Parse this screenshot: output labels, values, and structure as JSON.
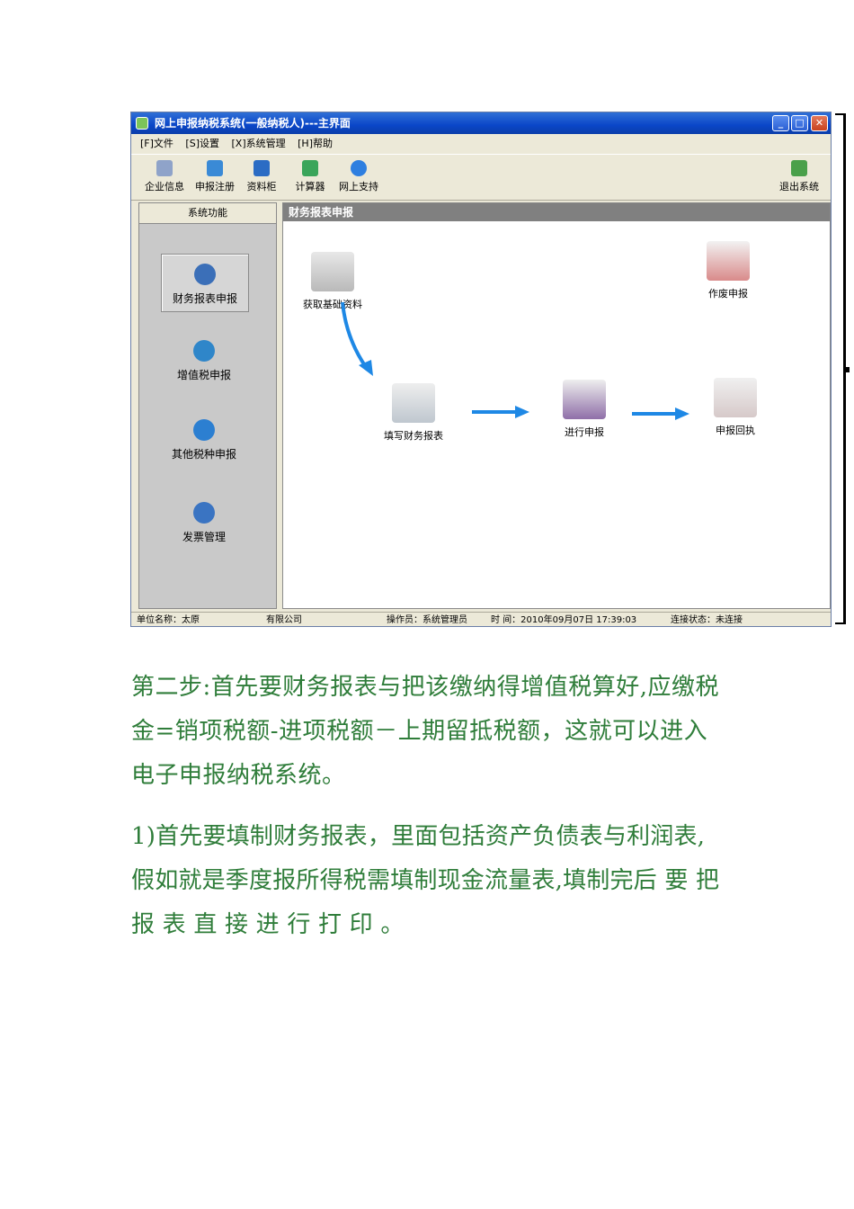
{
  "window": {
    "title": "网上申报纳税系统(一般纳税人)---主界面",
    "menu": [
      "[F]文件",
      "[S]设置",
      "[X]系统管理",
      "[H]帮助"
    ],
    "toolbar": [
      "企业信息",
      "申报注册",
      "资料柜",
      "计算器",
      "网上支持"
    ],
    "toolbar_right": "退出系统",
    "left_header": "系统功能",
    "nav_items": [
      "财务报表申报",
      "增值税申报",
      "其他税种申报",
      "发票管理"
    ],
    "main_header": "财务报表申报",
    "flow": {
      "get_data": "获取基础资料",
      "fill_report": "填写财务报表",
      "submit": "进行申报",
      "receipt": "申报回执",
      "void": "作废申报"
    },
    "status": {
      "unit_name": "单位名称：太原",
      "company": "有限公司",
      "operator": "操作员：系统管理员",
      "time": "时    间：2010年09月07日 17:39:03",
      "connection": "连接状态：未连接"
    }
  },
  "text": {
    "para1": "第二步:首先要财务报表与把该缴纳得增值税算好,应缴税金=销项税额-进项税额－上期留抵税额，这就可以进入电子申报纳税系统。",
    "para2": "1)首先要填制财务报表，里面包括资产负债表与利润表,假如就是季度报所得税需填制现金流量表,填制完后 要 把 报 表 直 接 进 行 打 印 。"
  },
  "colors": {
    "text_green": "#2f7d3a",
    "arrow_blue": "#1e88e5",
    "title_blue": "#0a46c8"
  }
}
